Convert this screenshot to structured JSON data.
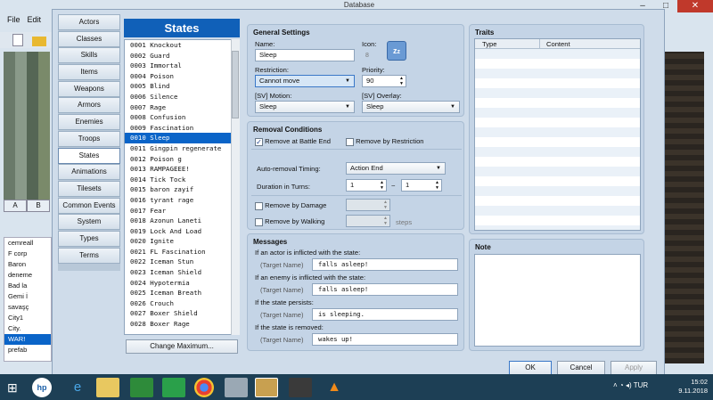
{
  "window": {
    "title": "Database"
  },
  "background": {
    "menu": [
      "File",
      "Edit"
    ],
    "tile_tabs": [
      "A",
      "B"
    ],
    "tree": [
      "cemreall",
      "F corp",
      "Baron",
      "deneme",
      "Bad la",
      "Gemi İ",
      "savaşç",
      "City1",
      "City.",
      "WAR!",
      "prefab"
    ],
    "tree_selected": 9
  },
  "categories": [
    "Actors",
    "Classes",
    "Skills",
    "Items",
    "Weapons",
    "Armors",
    "Enemies",
    "Troops",
    "States",
    "Animations",
    "Tilesets",
    "Common Events",
    "System",
    "Types",
    "Terms"
  ],
  "active_category": 8,
  "list": {
    "header": "States",
    "selected": 9,
    "items": [
      "0001 Knockout",
      "0002 Guard",
      "0003 Immortal",
      "0004 Poison",
      "0005 Blind",
      "0006 Silence",
      "0007 Rage",
      "0008 Confusion",
      "0009 Fascination",
      "0010 Sleep",
      "0011 Gingpin regenerate",
      "0012 Poison g",
      "0013 RAMPAGEEE!",
      "0014 Tick Tock",
      "0015 baron zayif",
      "0016 tyrant rage",
      "0017 Fear",
      "0018 Azonun Laneti",
      "0019 Lock And Load",
      "0020 Ignite",
      "0021 FL Fascination",
      "0022 Iceman Stun",
      "0023 Iceman Shield",
      "0024 Hypotermia",
      "0025 Iceman Breath",
      "0026 Crouch",
      "0027 Boxer Shield",
      "0028 Boxer Rage"
    ],
    "change_max": "Change Maximum..."
  },
  "general": {
    "title": "General Settings",
    "name_label": "Name:",
    "name": "Sleep",
    "icon_label": "Icon:",
    "icon_index": "8",
    "restriction_label": "Restriction:",
    "restriction": "Cannot move",
    "priority_label": "Priority:",
    "priority": "90",
    "motion_label": "[SV] Motion:",
    "motion": "Sleep",
    "overlay_label": "[SV] Overlay:",
    "overlay": "Sleep"
  },
  "removal": {
    "title": "Removal Conditions",
    "battle_end": "Remove at Battle End",
    "by_restriction": "Remove by Restriction",
    "timing_label": "Auto-removal Timing:",
    "timing": "Action End",
    "duration_label": "Duration in Turns:",
    "dur_min": "1",
    "tilde": "~",
    "dur_max": "1",
    "by_damage": "Remove by Damage",
    "by_walking": "Remove by Walking",
    "steps": "steps"
  },
  "messages": {
    "title": "Messages",
    "target": "(Target Name)",
    "rows": [
      {
        "label": "If an actor is inflicted with the state:",
        "text": "falls asleep!"
      },
      {
        "label": "If an enemy is inflicted with the state:",
        "text": "falls asleep!"
      },
      {
        "label": "If the state persists:",
        "text": "is sleeping."
      },
      {
        "label": "If the state is removed:",
        "text": "wakes up!"
      }
    ]
  },
  "traits": {
    "title": "Traits",
    "col_type": "Type",
    "col_content": "Content"
  },
  "note": {
    "title": "Note"
  },
  "buttons": {
    "ok": "OK",
    "cancel": "Cancel",
    "apply": "Apply"
  },
  "tray": {
    "lang": "TUR",
    "time": "15:02",
    "date": "9.11.2018"
  },
  "colors": {
    "selection": "#0a64c8",
    "header": "#1060b8",
    "taskbar": "#1d3f55"
  }
}
